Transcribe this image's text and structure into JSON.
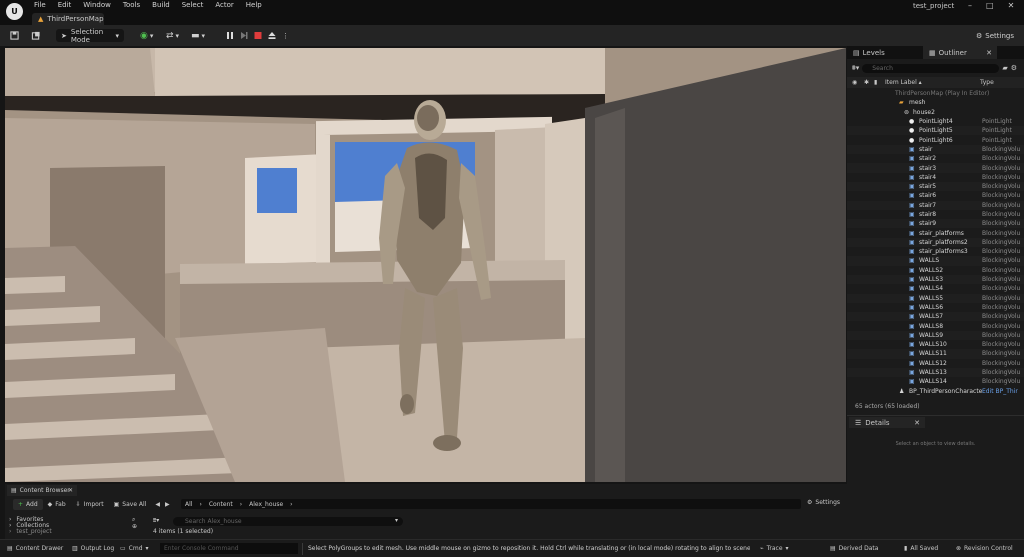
{
  "menu": [
    "File",
    "Edit",
    "Window",
    "Tools",
    "Build",
    "Select",
    "Actor",
    "Help"
  ],
  "project_name": "test_project",
  "window_controls": [
    "–",
    "□",
    "✕"
  ],
  "map_tab": "ThirdPersonMap",
  "toolbar": {
    "selection_mode": "Selection Mode",
    "settings": "Settings"
  },
  "right_panel": {
    "levels_tab": "Levels",
    "outliner_tab": "Outliner",
    "search_placeholder": "Search",
    "col_label": "Item Label ▴",
    "col_type": "Type",
    "root": "ThirdPersonMap (Play In Editor)",
    "folder_mesh": "mesh",
    "folder_house": "house2",
    "rows": [
      {
        "name": "PointLight4",
        "type": "PointLight",
        "icon": "light"
      },
      {
        "name": "PointLight5",
        "type": "PointLight",
        "icon": "light"
      },
      {
        "name": "PointLight6",
        "type": "PointLight",
        "icon": "light"
      },
      {
        "name": "stair",
        "type": "BlockingVolu",
        "icon": "mesh"
      },
      {
        "name": "stair2",
        "type": "BlockingVolu",
        "icon": "mesh"
      },
      {
        "name": "stair3",
        "type": "BlockingVolu",
        "icon": "mesh"
      },
      {
        "name": "stair4",
        "type": "BlockingVolu",
        "icon": "mesh"
      },
      {
        "name": "stair5",
        "type": "BlockingVolu",
        "icon": "mesh"
      },
      {
        "name": "stair6",
        "type": "BlockingVolu",
        "icon": "mesh"
      },
      {
        "name": "stair7",
        "type": "BlockingVolu",
        "icon": "mesh"
      },
      {
        "name": "stair8",
        "type": "BlockingVolu",
        "icon": "mesh"
      },
      {
        "name": "stair9",
        "type": "BlockingVolu",
        "icon": "mesh"
      },
      {
        "name": "stair_platforms",
        "type": "BlockingVolu",
        "icon": "mesh"
      },
      {
        "name": "stair_platforms2",
        "type": "BlockingVolu",
        "icon": "mesh"
      },
      {
        "name": "stair_platforms3",
        "type": "BlockingVolu",
        "icon": "mesh"
      },
      {
        "name": "WALLS",
        "type": "BlockingVolu",
        "icon": "mesh"
      },
      {
        "name": "WALLS2",
        "type": "BlockingVolu",
        "icon": "mesh"
      },
      {
        "name": "WALLS3",
        "type": "BlockingVolu",
        "icon": "mesh"
      },
      {
        "name": "WALLS4",
        "type": "BlockingVolu",
        "icon": "mesh"
      },
      {
        "name": "WALLS5",
        "type": "BlockingVolu",
        "icon": "mesh"
      },
      {
        "name": "WALLS6",
        "type": "BlockingVolu",
        "icon": "mesh"
      },
      {
        "name": "WALLS7",
        "type": "BlockingVolu",
        "icon": "mesh"
      },
      {
        "name": "WALLS8",
        "type": "BlockingVolu",
        "icon": "mesh"
      },
      {
        "name": "WALLS9",
        "type": "BlockingVolu",
        "icon": "mesh"
      },
      {
        "name": "WALLS10",
        "type": "BlockingVolu",
        "icon": "mesh"
      },
      {
        "name": "WALLS11",
        "type": "BlockingVolu",
        "icon": "mesh"
      },
      {
        "name": "WALLS12",
        "type": "BlockingVolu",
        "icon": "mesh"
      },
      {
        "name": "WALLS13",
        "type": "BlockingVolu",
        "icon": "mesh"
      },
      {
        "name": "WALLS14",
        "type": "BlockingVolu",
        "icon": "mesh"
      }
    ],
    "character_row": {
      "name": "BP_ThirdPersonCharacte",
      "type": "Edit BP_Thir"
    },
    "actor_count": "65 actors (65 loaded)",
    "details_tab": "Details",
    "details_empty": "Select an object to view details."
  },
  "content_browser": {
    "tab": "Content Browser",
    "add": "Add",
    "fab": "Fab",
    "import": "Import",
    "save_all": "Save All",
    "path_all": "All",
    "path_content": "Content",
    "path_folder": "Alex_house",
    "settings": "Settings",
    "favorites": "Favorites",
    "collections": "Collections",
    "project": "test_project",
    "search_placeholder": "Search Alex_house",
    "item_count": "4 items (1 selected)"
  },
  "status_bar": {
    "content_drawer": "Content Drawer",
    "output_log": "Output Log",
    "cmd": "Cmd",
    "console_placeholder": "Enter Console Command",
    "message": "Select PolyGroups to edit mesh. Use middle mouse on gizmo to reposition it. Hold Ctrl while translating or (in local mode) rotating to align to scene. Shift acc",
    "trace": "Trace",
    "derived_data": "Derived Data",
    "all_saved": "All Saved",
    "revision_control": "Revision Control"
  },
  "colors": {
    "accent_orange": "#e8a23a",
    "stop_red": "#e03c3c",
    "sky_blue": "#3d6fc8",
    "wall": "#a8988a"
  }
}
